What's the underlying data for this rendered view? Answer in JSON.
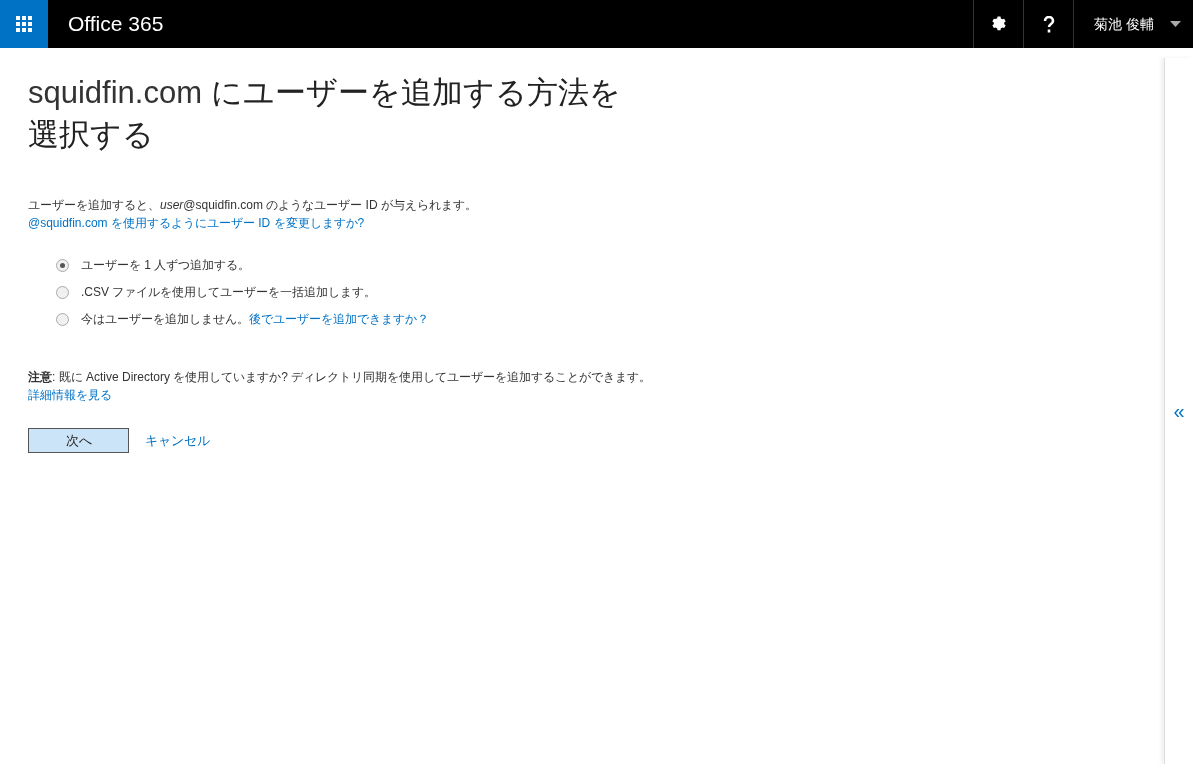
{
  "header": {
    "app_title": "Office 365",
    "user_name": "菊池 俊輔"
  },
  "page": {
    "heading_domain": "squidfin.com",
    "heading_rest": "にユーザーを追加する方法を選択する",
    "intro": "ユーザーを追加すると、*user*@squidfin.com のようなユーザー ID が与えられます。",
    "intro_link": "@squidfin.com を使用するようにユーザー ID を変更しますか?",
    "options": [
      {
        "label": "ユーザーを 1 人ずつ追加する。",
        "selected": true
      },
      {
        "label": ".CSV ファイルを使用してユーザーを一括追加します。",
        "selected": false
      },
      {
        "label": "今はユーザーを追加しません。",
        "link": "後でユーザーを追加できますか？",
        "selected": false
      }
    ],
    "note": "**注意**: 既に Active Directory を使用していますか? ディレクトリ同期を使用してユーザーを追加することができます。",
    "note_link": "詳細情報を見る",
    "next_button": "次へ",
    "cancel_link": "キャンセル"
  },
  "side_panel": {
    "toggle": "«"
  }
}
